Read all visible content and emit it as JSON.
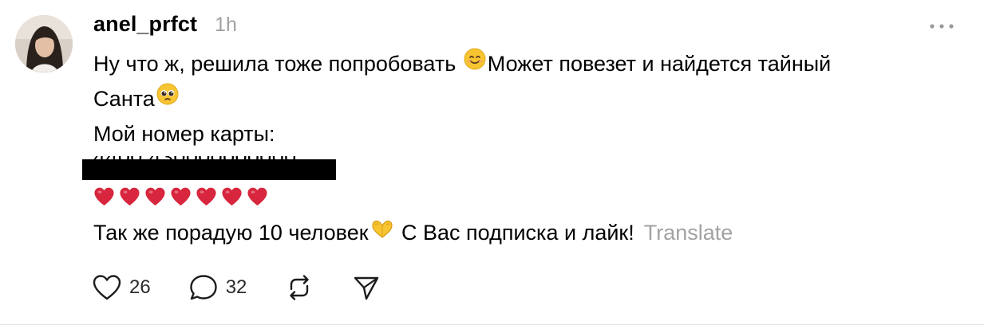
{
  "post": {
    "username": "anel_prfct",
    "time": "1h",
    "line1_a": "Ну что ж, решила тоже попробовать ",
    "line1_b": "Может повезет и найдется тайный",
    "line2": "Санта",
    "line3": "Мой номер карты:",
    "redacted_card": "4400 430000000000",
    "hearts_count": 7,
    "line5": "Так же порадую 10 человек",
    "line5_b": " С Вас подписка и лайк!",
    "translate_label": "Translate"
  },
  "actions": {
    "likes": "26",
    "replies": "32"
  },
  "icons": {
    "avatar": "avatar-photo",
    "more": "more-icon",
    "like": "heart-outline-icon",
    "reply": "comment-icon",
    "repost": "repost-icon",
    "share": "send-icon",
    "emoji1": "smiling-face-emoji",
    "emoji2": "pleading-face-emoji",
    "emoji3": "heart-hands-emoji",
    "heart": "red-heart-emoji"
  },
  "colors": {
    "muted": "#a2a2a2",
    "heart_red": "#d7263d",
    "emoji_yellow": "#f7c531"
  }
}
